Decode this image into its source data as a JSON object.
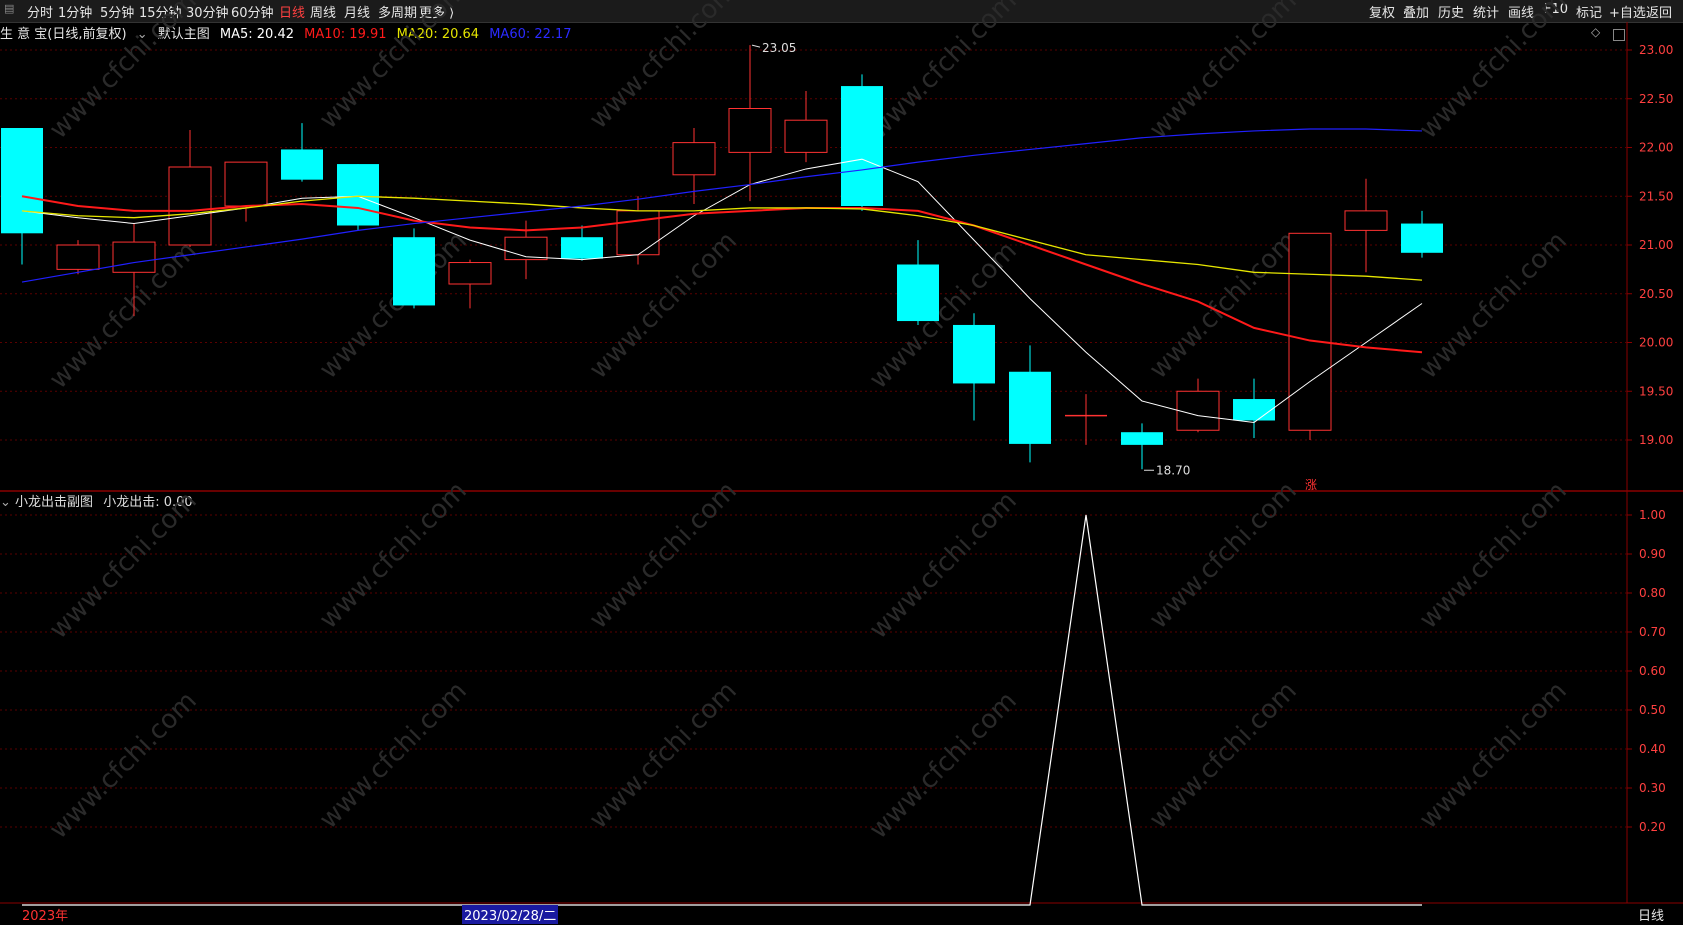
{
  "toolbar": {
    "left": [
      "分时",
      "1分钟",
      "5分钟",
      "15分钟",
      "30分钟",
      "60分钟",
      "日线",
      "周线",
      "月线",
      "多周期",
      "更多 ⟩"
    ],
    "active_index": 6,
    "right": [
      "复权",
      "叠加",
      "历史",
      "统计",
      "画线",
      "F10",
      "标记",
      "+自选",
      "返回"
    ]
  },
  "main_info": {
    "stock": "生 意 宝(日线,前复权)",
    "chart_name": "默认主图",
    "ma5": "MA5: 20.42",
    "ma10": "MA10: 19.91",
    "ma20": "MA20: 20.64",
    "ma60": "MA60: 22.17"
  },
  "sub_info": {
    "chart_name": "小龙出击副图",
    "value": "小龙出击: 0.00"
  },
  "footer": {
    "year": "2023年",
    "cursor_date": "2023/02/28/二",
    "period": "日线"
  },
  "colors": {
    "up": "#ff3232",
    "down": "#00ffff",
    "ma5": "#ffffff",
    "ma10": "#ff1a1a",
    "ma20": "#e6e600",
    "ma60": "#2020ff",
    "grid": "#5a0000"
  },
  "chart_data": [
    {
      "type": "candlestick",
      "ylim": [
        18.5,
        23.2
      ],
      "yticks": [
        "23.00",
        "22.50",
        "22.00",
        "21.50",
        "21.00",
        "20.50",
        "20.00",
        "19.50",
        "19.00"
      ],
      "annotations": {
        "high_label": "23.05",
        "low_label": "18.70",
        "marker": "涨"
      },
      "candles": [
        {
          "o": 22.2,
          "h": 22.2,
          "l": 20.8,
          "c": 21.12
        },
        {
          "o": 20.75,
          "h": 21.05,
          "l": 20.7,
          "c": 21.0
        },
        {
          "o": 20.72,
          "h": 21.22,
          "l": 20.27,
          "c": 21.03
        },
        {
          "o": 21.0,
          "h": 22.18,
          "l": 20.98,
          "c": 21.8
        },
        {
          "o": 21.4,
          "h": 21.85,
          "l": 21.24,
          "c": 21.85
        },
        {
          "o": 21.98,
          "h": 22.25,
          "l": 21.65,
          "c": 21.67
        },
        {
          "o": 21.83,
          "h": 21.83,
          "l": 21.15,
          "c": 21.2
        },
        {
          "o": 21.08,
          "h": 21.17,
          "l": 20.35,
          "c": 20.38
        },
        {
          "o": 20.6,
          "h": 20.85,
          "l": 20.35,
          "c": 20.82
        },
        {
          "o": 20.85,
          "h": 21.25,
          "l": 20.65,
          "c": 21.08
        },
        {
          "o": 21.08,
          "h": 21.2,
          "l": 20.84,
          "c": 20.86
        },
        {
          "o": 20.9,
          "h": 21.5,
          "l": 20.8,
          "c": 21.35
        },
        {
          "o": 21.72,
          "h": 22.2,
          "l": 21.42,
          "c": 22.05
        },
        {
          "o": 21.95,
          "h": 23.05,
          "l": 21.45,
          "c": 22.4
        },
        {
          "o": 21.95,
          "h": 22.58,
          "l": 21.85,
          "c": 22.28
        },
        {
          "o": 22.63,
          "h": 22.75,
          "l": 21.35,
          "c": 21.4
        },
        {
          "o": 20.8,
          "h": 21.05,
          "l": 20.18,
          "c": 20.22
        },
        {
          "o": 20.18,
          "h": 20.3,
          "l": 19.2,
          "c": 19.58
        },
        {
          "o": 19.7,
          "h": 19.97,
          "l": 18.77,
          "c": 18.96
        },
        {
          "o": 19.25,
          "h": 19.47,
          "l": 18.95,
          "c": 19.25
        },
        {
          "o": 19.08,
          "h": 19.17,
          "l": 18.7,
          "c": 18.95
        },
        {
          "o": 19.1,
          "h": 19.63,
          "l": 19.08,
          "c": 19.5
        },
        {
          "o": 19.42,
          "h": 19.63,
          "l": 19.02,
          "c": 19.2
        },
        {
          "o": 19.1,
          "h": 21.12,
          "l": 19.0,
          "c": 21.12
        },
        {
          "o": 21.15,
          "h": 21.68,
          "l": 20.72,
          "c": 21.35
        },
        {
          "o": 21.22,
          "h": 21.35,
          "l": 20.87,
          "c": 20.92
        }
      ],
      "series": [
        {
          "name": "MA5",
          "values": [
            21.35,
            21.28,
            21.22,
            21.3,
            21.38,
            21.48,
            21.5,
            21.28,
            21.05,
            20.88,
            20.85,
            20.9,
            21.3,
            21.62,
            21.78,
            21.88,
            21.65,
            21.05,
            20.45,
            19.9,
            19.4,
            19.25,
            19.18,
            19.6,
            20.0,
            20.4
          ]
        },
        {
          "name": "MA10",
          "values": [
            21.5,
            21.4,
            21.35,
            21.35,
            21.4,
            21.42,
            21.38,
            21.25,
            21.18,
            21.15,
            21.18,
            21.25,
            21.32,
            21.35,
            21.38,
            21.38,
            21.35,
            21.2,
            21.0,
            20.8,
            20.6,
            20.42,
            20.15,
            20.02,
            19.95,
            19.9
          ]
        },
        {
          "name": "MA20",
          "values": [
            21.35,
            21.3,
            21.28,
            21.32,
            21.38,
            21.45,
            21.5,
            21.48,
            21.45,
            21.42,
            21.38,
            21.35,
            21.35,
            21.38,
            21.38,
            21.37,
            21.3,
            21.2,
            21.05,
            20.9,
            20.85,
            20.8,
            20.72,
            20.7,
            20.68,
            20.64
          ]
        },
        {
          "name": "MA60",
          "values": [
            20.62,
            20.72,
            20.82,
            20.9,
            20.98,
            21.06,
            21.15,
            21.22,
            21.28,
            21.34,
            21.4,
            21.47,
            21.55,
            21.62,
            21.7,
            21.77,
            21.85,
            21.92,
            21.98,
            22.04,
            22.1,
            22.14,
            22.17,
            22.19,
            22.19,
            22.17
          ]
        }
      ]
    },
    {
      "type": "line",
      "ylim": [
        0,
        1.0
      ],
      "yticks": [
        "1.00",
        "0.90",
        "0.80",
        "0.70",
        "0.60",
        "0.50",
        "0.40",
        "0.30",
        "0.20"
      ],
      "series": [
        {
          "name": "小龙出击",
          "values": [
            0,
            0,
            0,
            0,
            0,
            0,
            0,
            0,
            0,
            0,
            0,
            0,
            0,
            0,
            0,
            0,
            0,
            0,
            0,
            1,
            0,
            0,
            0,
            0,
            0,
            0
          ]
        }
      ]
    }
  ]
}
